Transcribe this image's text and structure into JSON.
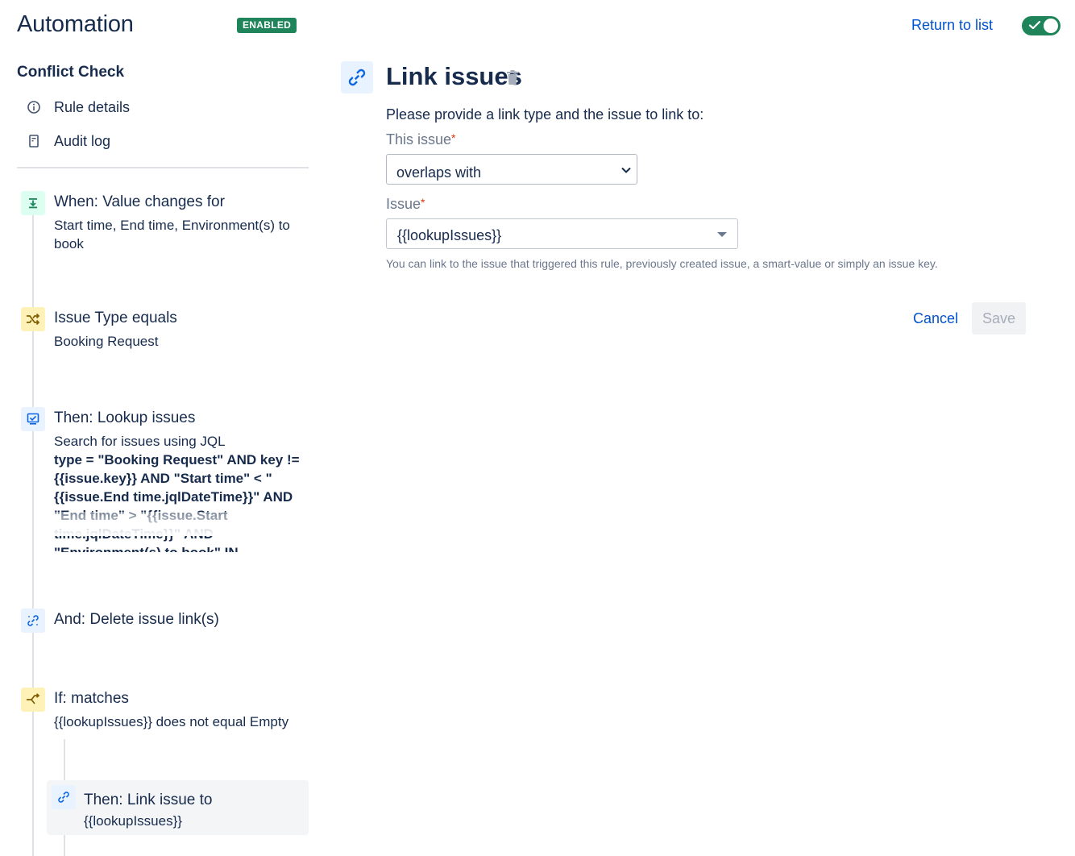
{
  "header": {
    "title": "Automation",
    "status_badge": "ENABLED",
    "return_link": "Return to list",
    "toggle_on": true
  },
  "sidebar": {
    "rule_name": "Conflict Check",
    "nav": [
      {
        "label": "Rule details",
        "icon": "info-icon"
      },
      {
        "label": "Audit log",
        "icon": "document-icon"
      }
    ]
  },
  "steps": [
    {
      "title": "When: Value changes for",
      "desc": "Start time, End time, Environment(s) to book",
      "icon": "trigger-icon"
    },
    {
      "title": "Issue Type equals",
      "desc": "Booking Request",
      "icon": "shuffle-icon"
    },
    {
      "title": "Then: Lookup issues",
      "desc": "Search for issues using JQL",
      "jql": "type = \"Booking Request\" AND key != {{issue.key}} AND \"Start time\" < \"{{issue.End time.jqlDateTime}}\" AND \"End time\" > \"{{issue.Start time.jqlDateTime}}\" AND \"Environment(s) to book\" IN",
      "icon": "lookup-icon"
    },
    {
      "title": "And: Delete issue link(s)",
      "icon": "unlink-icon"
    },
    {
      "title": "If: matches",
      "desc": "{{lookupIssues}} does not equal Empty",
      "icon": "branch-icon"
    },
    {
      "title": "Then: Link issue to",
      "desc": "{{lookupIssues}}",
      "icon": "link-icon"
    }
  ],
  "panel": {
    "title": "Link issues",
    "instructions": "Please provide a link type and the issue to link to:",
    "this_issue_label": "This issue",
    "this_issue_value": "overlaps with",
    "issue_label": "Issue",
    "issue_value": "{{lookupIssues}}",
    "help_text": "You can link to the issue that triggered this rule, previously created issue, a smart-value or simply an issue key.",
    "required_mark": "*",
    "cancel_label": "Cancel",
    "save_label": "Save"
  },
  "colors": {
    "accent": "#0052cc",
    "enabled_green": "#1f845a",
    "text": "#172b4d",
    "required": "#de350b"
  }
}
